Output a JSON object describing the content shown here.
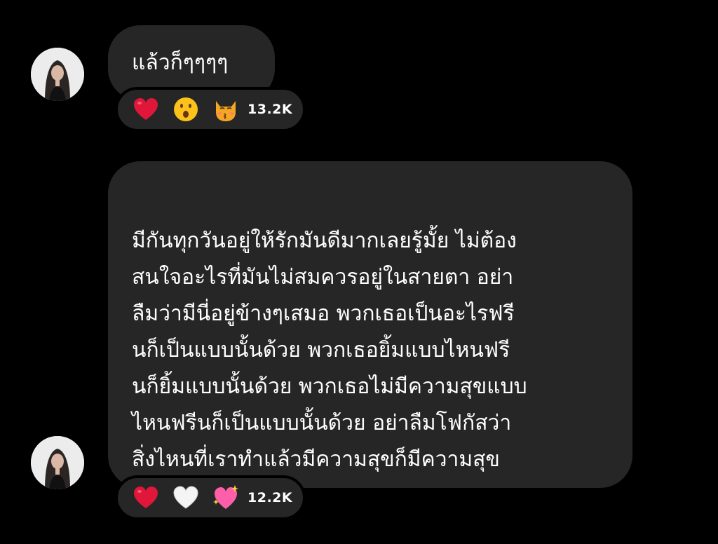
{
  "messages": [
    {
      "text": "แล้วก็ๆๆๆๆ",
      "reactions": {
        "emojis": [
          "red-heart",
          "hushed-face",
          "kissing-cat"
        ],
        "count": "13.2K"
      }
    },
    {
      "text": "มีกันทุกวันอยู่ให้รักมันดีมากเลยรู้มั้ย ไม่ต้อง\nสนใจอะไรที่มันไม่สมควรอยู่ในสายตา อย่า\nลืมว่ามีนี่อยู่ข้างๆเสมอ พวกเธอเป็นอะไรฟรี\nนก็เป็นแบบนั้นด้วย พวกเธอยิ้มแบบไหนฟรี\nนก็ยิ้มแบบนั้นด้วย พวกเธอไม่มีความสุขแบบ\nไหนฟรีนก็เป็นแบบนั้นด้วย อย่าลืมโฟกัสว่า\nสิ่งไหนที่เราทำแล้วมีความสุขก็มีความสุข\nด้วยกันเถอะ",
      "reactions": {
        "emojis": [
          "red-heart",
          "white-heart",
          "sparkling-heart"
        ],
        "count": "12.2K"
      }
    }
  ],
  "colors": {
    "background": "#000000",
    "bubble": "#262626",
    "text": "#ffffff",
    "heart_red": "#e0163a",
    "sparkling_heart": "#ff5fa8"
  }
}
